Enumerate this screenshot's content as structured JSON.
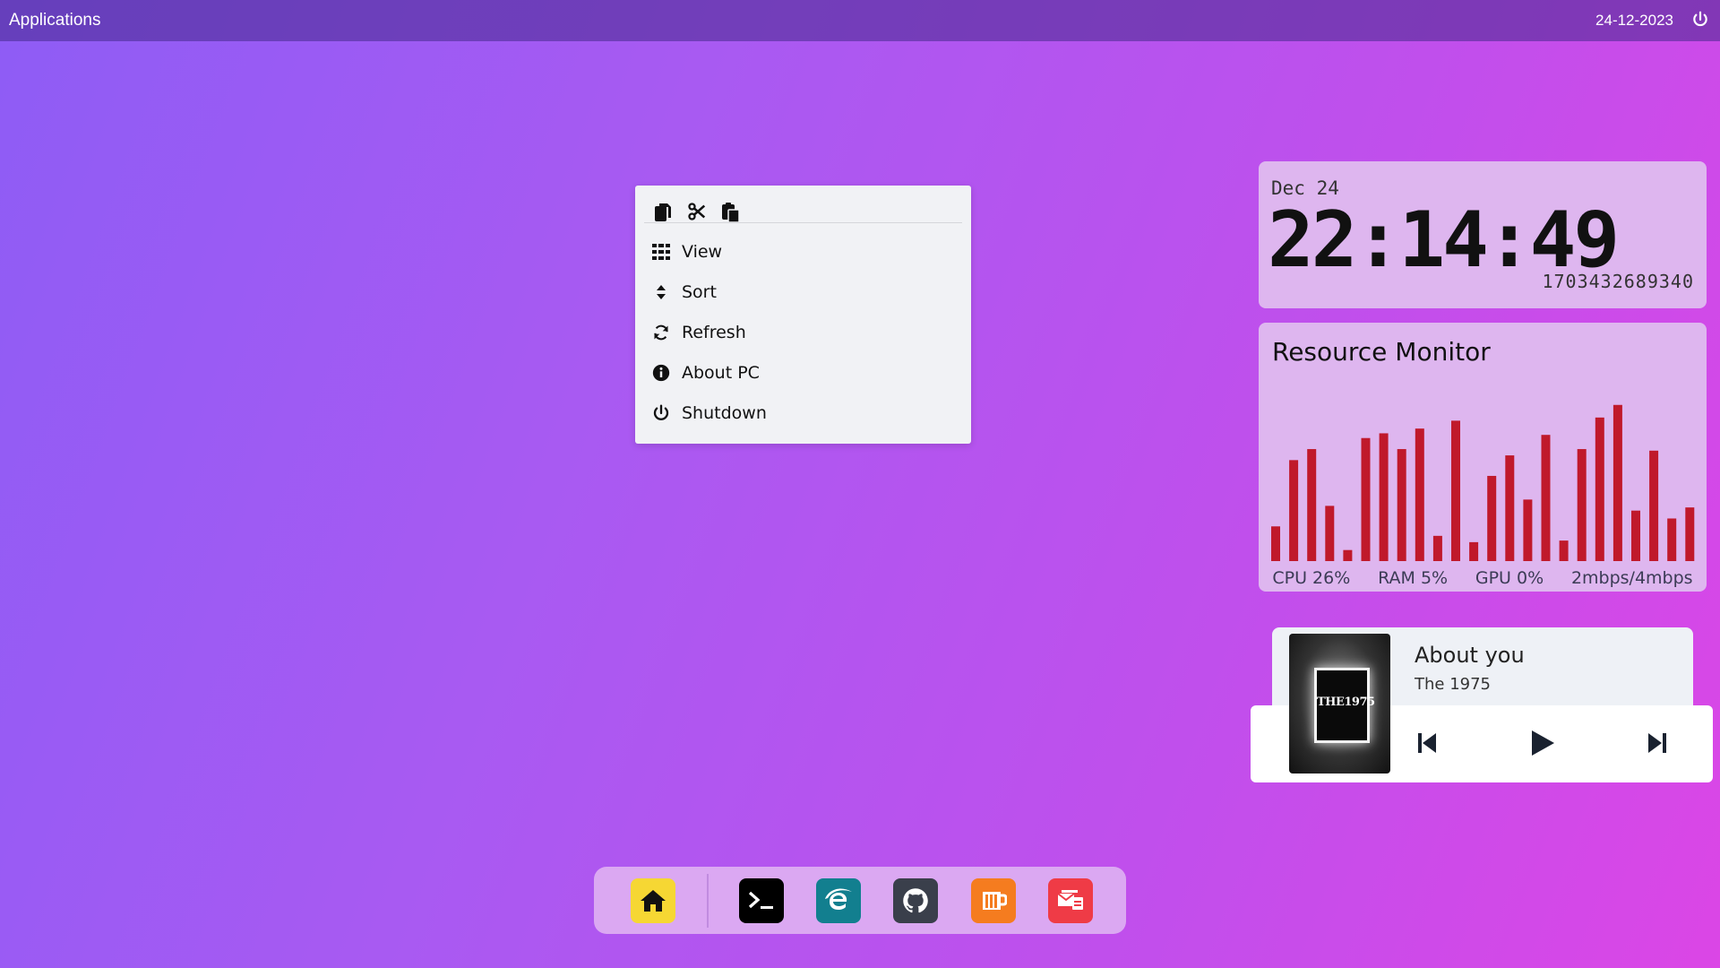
{
  "topbar": {
    "applications_label": "Applications",
    "date": "24-12-2023",
    "power_icon": "power-icon"
  },
  "context_menu": {
    "clipboard_icons": [
      "copy-icon",
      "cut-icon",
      "paste-icon"
    ],
    "items": [
      {
        "label": "View",
        "icon": "grid-icon"
      },
      {
        "label": "Sort",
        "icon": "sort-icon"
      },
      {
        "label": "Refresh",
        "icon": "refresh-icon"
      },
      {
        "label": "About PC",
        "icon": "info-icon"
      },
      {
        "label": "Shutdown",
        "icon": "power-icon"
      }
    ]
  },
  "clock": {
    "day": "Dec 24",
    "time": "22:14:49",
    "timestamp": "1703432689340"
  },
  "resource_monitor": {
    "title": "Resource Monitor",
    "bar_color": "#c0192b",
    "bar_levels": [
      0.22,
      0.64,
      0.71,
      0.35,
      0.07,
      0.78,
      0.81,
      0.71,
      0.84,
      0.16,
      0.89,
      0.12,
      0.54,
      0.67,
      0.39,
      0.8,
      0.13,
      0.71,
      0.91,
      0.99,
      0.32,
      0.7,
      0.27,
      0.34
    ],
    "stats": {
      "cpu": "CPU 26%",
      "ram": "RAM 5%",
      "gpu": "GPU 0%",
      "net": "2mbps/4mbps"
    }
  },
  "music": {
    "song": "About you",
    "artist": "The 1975",
    "cover_text": "THE1975",
    "controls": [
      "previous-icon",
      "play-icon",
      "next-icon"
    ]
  },
  "dock": {
    "apps": [
      {
        "name": "home",
        "color": "#f6d733"
      },
      {
        "name": "terminal",
        "color": "#000000"
      },
      {
        "name": "edge-browser",
        "color": "#127f8f"
      },
      {
        "name": "github",
        "color": "#3a3f4b"
      },
      {
        "name": "sublime-text",
        "color": "#f57c1f"
      },
      {
        "name": "mail",
        "color": "#ef3b46"
      }
    ]
  }
}
